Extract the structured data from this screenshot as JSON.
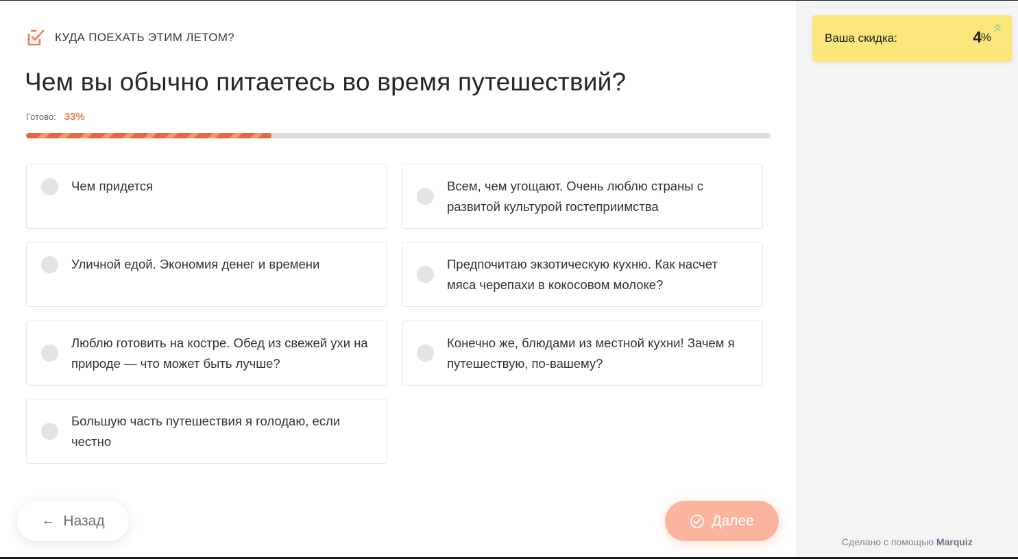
{
  "quiz": {
    "title": "КУДА ПОЕХАТЬ ЭТИМ ЛЕТОМ?",
    "question": "Чем вы обычно питаетесь во время путешествий?",
    "progress_label": "Готово:",
    "progress_text": "33%",
    "progress_value": 33,
    "accent": "#f07a4a"
  },
  "options": [
    "Чем придется",
    "Всем, чем угощают. Очень люблю страны с развитой культурой гостеприимства",
    "Уличной едой. Экономия денег и времени",
    "Предпочитаю экзотическую кухню. Как насчет мяса черепахи в кокосовом молоке?",
    "Люблю готовить на костре. Обед из свежей ухи на природе — что может быть лучше?",
    "Конечно же, блюдами из местной кухни! Зачем я путешествую, по-вашему?",
    "Большую часть путешествия я голодаю, если честно"
  ],
  "nav": {
    "back_label": "Назад",
    "next_label": "Далее"
  },
  "sidebar": {
    "discount_label": "Ваша скидка:",
    "discount_value": "4",
    "discount_unit": "%",
    "discount_color": "#fbe67c",
    "credit_prefix": "Сделано с помощью",
    "credit_brand": "Marquiz"
  },
  "icons": {
    "header": "checklist-icon",
    "back": "arrow-left-icon",
    "next": "check-circle-icon",
    "discount_trend": "double-chevron-up-icon"
  }
}
